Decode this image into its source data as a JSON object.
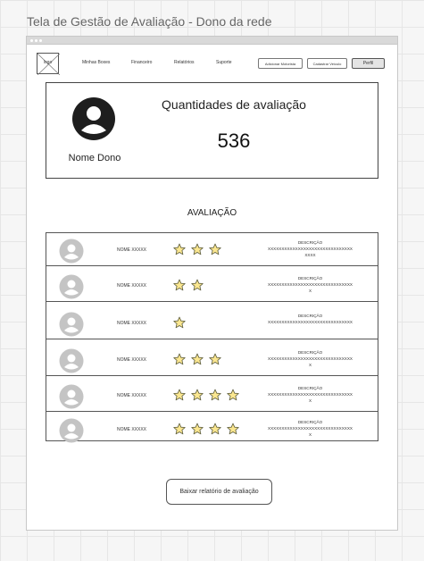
{
  "board": {
    "title": "Tela de Gestão de  Avaliação - Dono da rede"
  },
  "nav": {
    "logo_label": "logo",
    "links": [
      "Minhas Boxes",
      "Financeiro",
      "Relatórios",
      "Suporte"
    ],
    "buttons": [
      "Adicionar Motorista",
      "Cadastrar Veículo"
    ],
    "profile_label": "Perfil"
  },
  "summary": {
    "owner_name": "Nome Dono",
    "quantity_label": "Quantidades de avaliação",
    "quantity_value": "536"
  },
  "section": {
    "title": "AVALIAÇÃO"
  },
  "reviews": [
    {
      "name": "NOME XXXXX",
      "rating": 3,
      "desc_label": "DESCRIÇÃO",
      "desc_text": "XXXXXXXXXXXXXXXXXXXXXXXXXXXXXXXXXXX"
    },
    {
      "name": "NOME XXXXX",
      "rating": 2,
      "desc_label": "DESCRIÇÃO",
      "desc_text": "XXXXXXXXXXXXXXXXXXXXXXXXXXXXXXXX"
    },
    {
      "name": "NOME XXXXX",
      "rating": 1,
      "desc_label": "DESCRIÇÃO",
      "desc_text": "XXXXXXXXXXXXXXXXXXXXXXXXXXXXXXX"
    },
    {
      "name": "NOME XXXXX",
      "rating": 3,
      "desc_label": "DESCRIÇÃO",
      "desc_text": "XXXXXXXXXXXXXXXXXXXXXXXXXXXXXXXX"
    },
    {
      "name": "NOME XXXXX",
      "rating": 4,
      "desc_label": "DESCRIÇÃO",
      "desc_text": "XXXXXXXXXXXXXXXXXXXXXXXXXXXXXXXX"
    },
    {
      "name": "NOME XXXXX",
      "rating": 4,
      "desc_label": "DESCRIÇÃO",
      "desc_text": "XXXXXXXXXXXXXXXXXXXXXXXXXXXXXXXX"
    }
  ],
  "footer": {
    "download_label": "Baixar relatório de avaliação"
  },
  "colors": {
    "star_fill": "#fbe790",
    "star_stroke": "#5a5a3a",
    "avatar_gray": "#c4c4c4",
    "avatar_dark": "#1e1e1e"
  }
}
